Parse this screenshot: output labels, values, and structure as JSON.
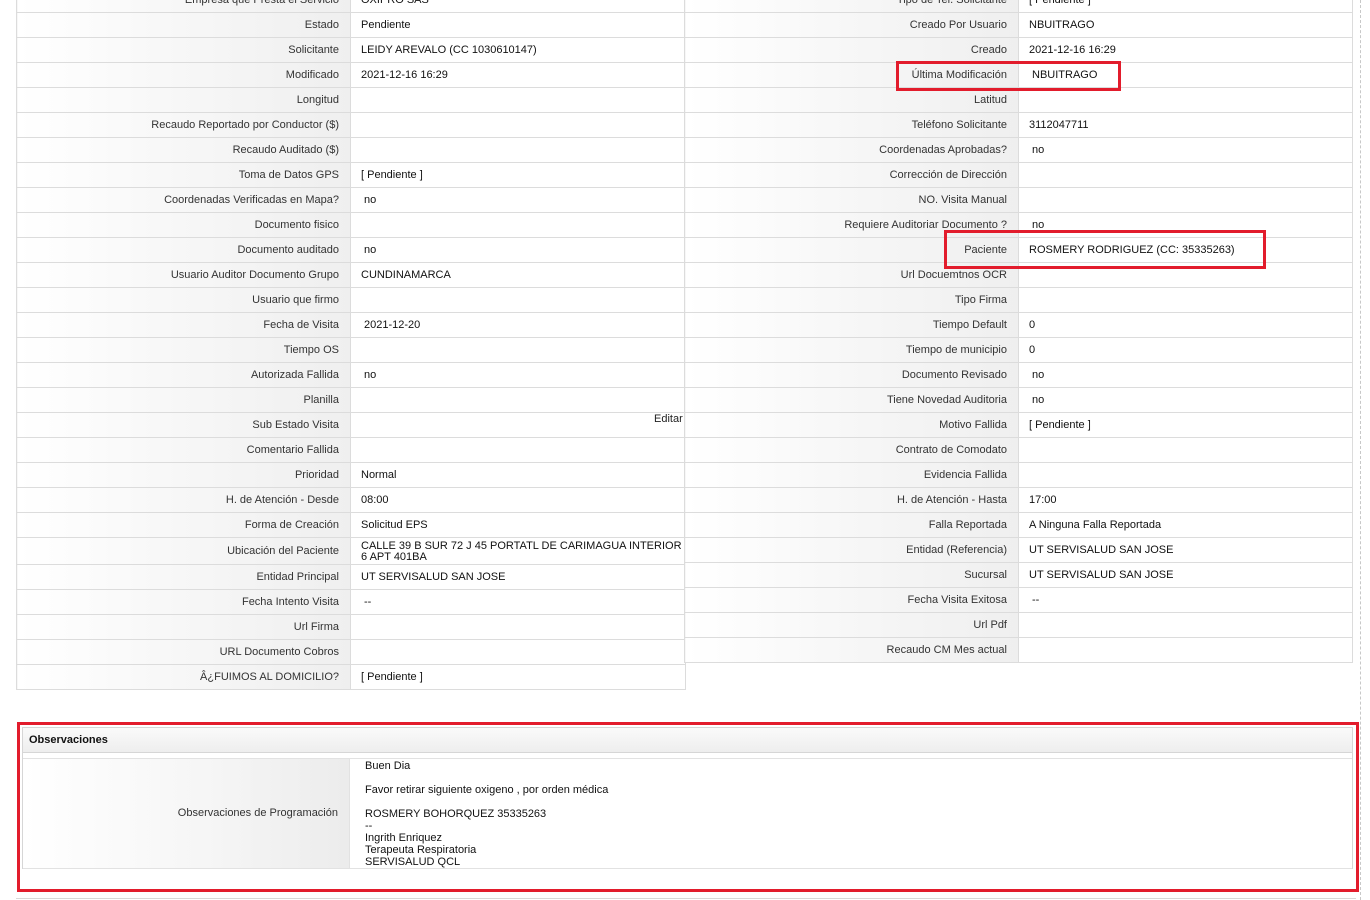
{
  "left_rows": [
    {
      "label": "Empresa que Presta el Servicio",
      "value": "OXIPRO SAS"
    },
    {
      "label": "Estado",
      "value": "Pendiente"
    },
    {
      "label": "Solicitante",
      "value": "LEIDY AREVALO (CC 1030610147)"
    },
    {
      "label": "Modificado",
      "value": "2021-12-16 16:29"
    },
    {
      "label": "Longitud",
      "value": ""
    },
    {
      "label": "Recaudo Reportado por Conductor ($)",
      "value": ""
    },
    {
      "label": "Recaudo Auditado ($)",
      "value": ""
    },
    {
      "label": "Toma de Datos GPS",
      "value": "[ Pendiente ]"
    },
    {
      "label": "Coordenadas Verificadas en Mapa?",
      "value": "no"
    },
    {
      "label": "Documento fisico",
      "value": ""
    },
    {
      "label": "Documento auditado",
      "value": "no"
    },
    {
      "label": "Usuario Auditor Documento Grupo",
      "value": "CUNDINAMARCA"
    },
    {
      "label": "Usuario que firmo",
      "value": ""
    },
    {
      "label": "Fecha de Visita",
      "value": "2021-12-20"
    },
    {
      "label": "Tiempo OS",
      "value": ""
    },
    {
      "label": "Autorizada Fallida",
      "value": "no"
    },
    {
      "label": "Planilla",
      "value": ""
    },
    {
      "label": "Sub Estado Visita",
      "value": ""
    },
    {
      "label": "Comentario Fallida",
      "value": ""
    },
    {
      "label": "Prioridad",
      "value": "Normal"
    },
    {
      "label": "H. de Atención - Desde",
      "value": "08:00"
    },
    {
      "label": "Forma de Creación",
      "value": "Solicitud EPS"
    },
    {
      "label": "Ubicación del Paciente",
      "value": "CALLE 39 B SUR 72 J 45 PORTATL DE CARIMAGUA INTERIOR 6 APT 401BA"
    },
    {
      "label": "Entidad Principal",
      "value": "UT SERVISALUD SAN JOSE"
    },
    {
      "label": "Fecha Intento Visita",
      "value": "--"
    },
    {
      "label": "Url Firma",
      "value": ""
    },
    {
      "label": "URL Documento Cobros",
      "value": ""
    },
    {
      "label": "Â¿FUIMOS AL DOMICILIO?",
      "value": "[ Pendiente ]"
    }
  ],
  "right_rows": [
    {
      "label": "Tipo de Tel. Solicitante",
      "value": "[ Pendiente ]"
    },
    {
      "label": "Creado Por Usuario",
      "value": "NBUITRAGO"
    },
    {
      "label": "Creado",
      "value": "2021-12-16 16:29"
    },
    {
      "label": "Última Modificación",
      "value": "NBUITRAGO"
    },
    {
      "label": "Latitud",
      "value": ""
    },
    {
      "label": "Teléfono Solicitante",
      "value": "3112047711"
    },
    {
      "label": "Coordenadas Aprobadas?",
      "value": "no"
    },
    {
      "label": "Corrección de Dirección",
      "value": ""
    },
    {
      "label": "NO. Visita Manual",
      "value": ""
    },
    {
      "label": "Requiere Auditoriar Documento ?",
      "value": "no"
    },
    {
      "label": "Paciente",
      "value": "ROSMERY RODRIGUEZ (CC: 35335263)"
    },
    {
      "label": "Url Docuemtnos OCR",
      "value": ""
    },
    {
      "label": "Tipo Firma",
      "value": ""
    },
    {
      "label": "Tiempo Default",
      "value": "0"
    },
    {
      "label": "Tiempo de municipio",
      "value": "0"
    },
    {
      "label": "Documento Revisado",
      "value": "no"
    },
    {
      "label": "Tiene Novedad Auditoria",
      "value": "no"
    },
    {
      "label": "Motivo Fallida",
      "value": "[ Pendiente ]"
    },
    {
      "label": "Contrato de Comodato",
      "value": ""
    },
    {
      "label": "Evidencia Fallida",
      "value": ""
    },
    {
      "label": "H. de Atención - Hasta",
      "value": "17:00"
    },
    {
      "label": "Falla Reportada",
      "value": "A Ninguna Falla Reportada"
    },
    {
      "label": "Entidad (Referencia)",
      "value": "UT SERVISALUD SAN JOSE"
    },
    {
      "label": "Sucursal",
      "value": "UT SERVISALUD SAN JOSE"
    },
    {
      "label": "Fecha Visita Exitosa",
      "value": "--"
    },
    {
      "label": "Url Pdf",
      "value": ""
    },
    {
      "label": "Recaudo CM Mes actual",
      "value": ""
    }
  ],
  "edit_link": "Editar",
  "observaciones": {
    "title": "Observaciones",
    "label": "Observaciones de Programación",
    "lines": [
      " Buen Dia",
      "",
      "Favor retirar siguiente oxigeno , por orden médica",
      "",
      "ROSMERY BOHORQUEZ 35335263",
      "--",
      "Ingrith Enriquez",
      "Terapeuta Respiratoria",
      "SERVISALUD QCL"
    ]
  },
  "annotation_color": "#e21c2c"
}
